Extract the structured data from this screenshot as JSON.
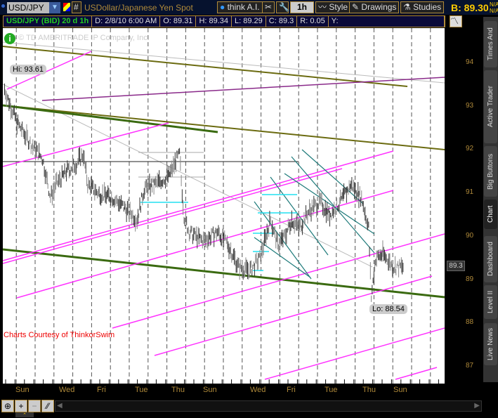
{
  "toolbar": {
    "symbol": "USD/JPY",
    "description": "USDollar/Japanese Yen Spot",
    "think_ai": "think A.I.",
    "timeframe": "1h",
    "style": "Style",
    "drawings": "Drawings",
    "studies": "Studies",
    "bid": "B: 89.30",
    "na1": "N/A",
    "na2": "N/A",
    "hash": "#"
  },
  "info": {
    "title": "USD/JPY (BID) 20 d 1h",
    "date": "D: 2/8/10 6:00 AM",
    "open": "O: 89.31",
    "high": "H: 89.34",
    "low": "L: 89.29",
    "close": "C: 89.3",
    "range": "R: 0.05",
    "y": "Y:"
  },
  "copyright": "9 © TD AMERITRADE IP Company, Inc.",
  "annotations": {
    "hi": "Hi: 93.61",
    "lo": "Lo: 88.54",
    "credit": "Charts Courtesy of ThinkorSwim",
    "last": "89.3"
  },
  "side_tabs": [
    "Times And Sales",
    "Active Trader",
    "Big Buttons",
    "Chart",
    "Dashboard",
    "Level II",
    "Live News"
  ],
  "colors": {
    "up": "#888888",
    "down": "#333333",
    "magenta": "#ff33ff",
    "olive": "#6b6b10",
    "green": "#3a6a10",
    "teal": "#1e7a7a",
    "cyan": "#22e0f0"
  },
  "chart_data": {
    "type": "line",
    "title": "USD/JPY (BID) 20 d 1h",
    "xlabel": "",
    "ylabel": "",
    "ylim": [
      86.7,
      94.8
    ],
    "yticks": [
      "94",
      "93",
      "92",
      "91",
      "90",
      "89",
      "88",
      "87"
    ],
    "xticks": [
      "Sun",
      "Wed",
      "Fri",
      "Tue",
      "Thu",
      "Sun",
      "Wed",
      "Fri",
      "Tue",
      "Thu",
      "Sun"
    ],
    "bar_hours": [
      2,
      9,
      17,
      33,
      45,
      54,
      60,
      72,
      84,
      91,
      96,
      108,
      124,
      136,
      152,
      160,
      172,
      188,
      200,
      202,
      205,
      211,
      227,
      243,
      255,
      267,
      279,
      291,
      303,
      311,
      319,
      327,
      335,
      347,
      359,
      370,
      382,
      394,
      406,
      414,
      417,
      422,
      430,
      442,
      454
    ],
    "price": [
      93.4,
      93.0,
      92.6,
      92.1,
      91.8,
      90.9,
      91.2,
      91.5,
      91.7,
      91.9,
      91.2,
      91.0,
      90.9,
      90.7,
      90.4,
      91.1,
      91.2,
      91.4,
      91.9,
      91.3,
      90.5,
      90.1,
      89.9,
      90.1,
      89.8,
      89.3,
      89.2,
      89.5,
      90.4,
      89.8,
      90.0,
      90.4,
      90.2,
      90.6,
      90.8,
      90.5,
      90.8,
      91.2,
      90.9,
      90.2,
      88.6,
      89.5,
      89.6,
      89.3,
      89.3
    ],
    "high": 93.61,
    "low": 88.54,
    "last": 89.3
  }
}
